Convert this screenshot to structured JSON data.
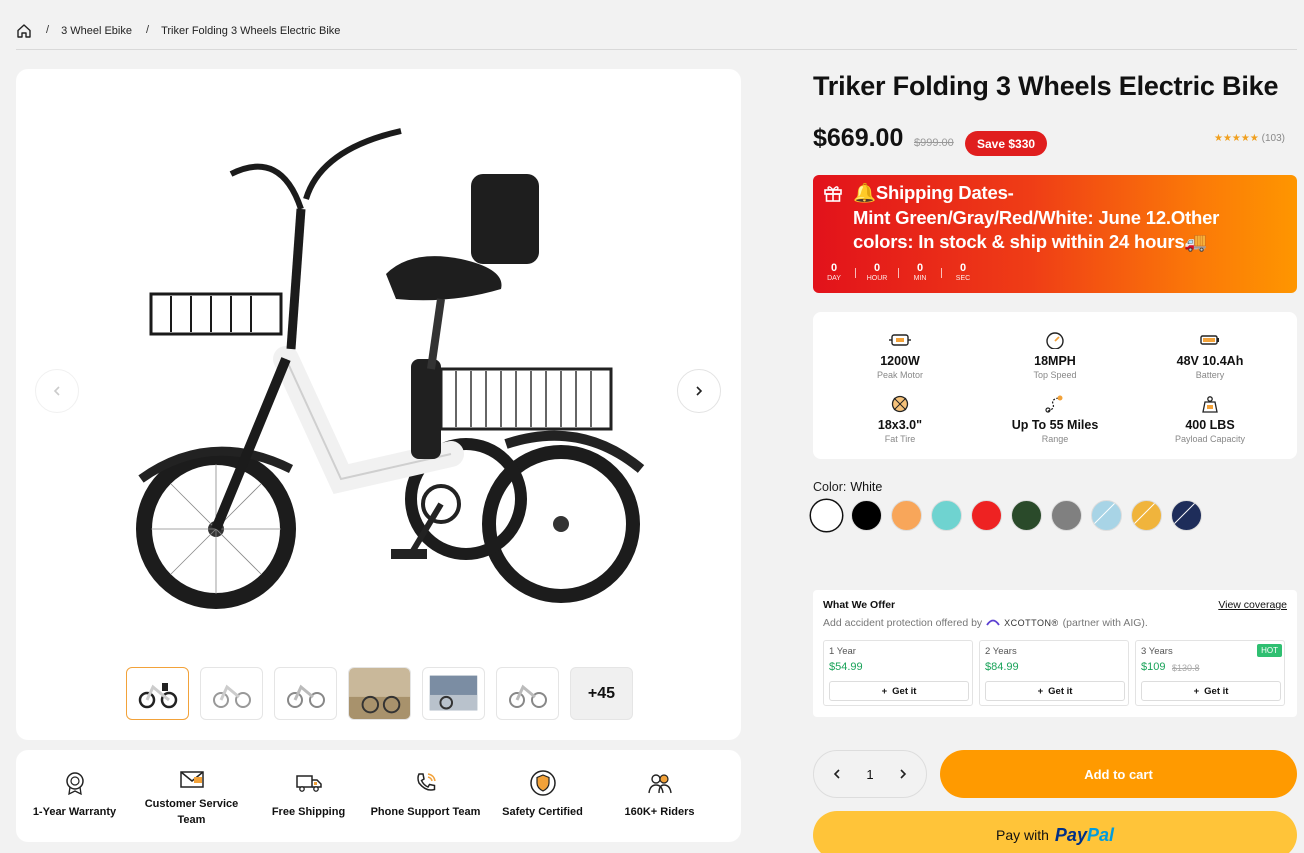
{
  "breadcrumb": {
    "home_icon": "home-icon",
    "items": [
      "3 Wheel Ebike",
      "Triker Folding 3 Wheels Electric Bike"
    ]
  },
  "product": {
    "title": "Triker Folding 3 Wheels Electric Bike",
    "price": "$669.00",
    "old_price": "$999.00",
    "save": "Save $330",
    "rating_stars": "★★★★★",
    "rating_count": "(103)"
  },
  "shipping": {
    "line": "🔔Shipping Dates-\nMint Green/Gray/Red/White: June 12.Other colors: In stock & ship within 24 hours🚚",
    "countdown": [
      {
        "value": "0",
        "unit": "DAY"
      },
      {
        "value": "0",
        "unit": "HOUR"
      },
      {
        "value": "0",
        "unit": "MIN"
      },
      {
        "value": "0",
        "unit": "SEC"
      }
    ]
  },
  "specs": [
    {
      "value": "1200W",
      "label": "Peak Motor",
      "icon": "motor-icon"
    },
    {
      "value": "18MPH",
      "label": "Top Speed",
      "icon": "speedometer-icon"
    },
    {
      "value": "48V 10.4Ah",
      "label": "Battery",
      "icon": "battery-icon"
    },
    {
      "value": "18x3.0\"",
      "label": "Fat Tire",
      "icon": "tire-icon"
    },
    {
      "value": "Up To 55 Miles",
      "label": "Range",
      "icon": "route-icon"
    },
    {
      "value": "400 LBS",
      "label": "Payload Capacity",
      "icon": "weight-icon"
    }
  ],
  "color": {
    "label": "Color:",
    "selected": "White",
    "swatches": [
      "#ffffff",
      "#000000",
      "#f8a65a",
      "#6fd3d0",
      "#ee2222",
      "#2a4a2a",
      "#808080",
      "#a8d4e6",
      "#f0b43c",
      "#1e2d5a"
    ]
  },
  "offer": {
    "heading": "What We Offer",
    "view_coverage": "View coverage",
    "sub_before": "Add accident protection offered by",
    "brand": "XCOTTON®",
    "sub_after": "(partner with AIG).",
    "plans": [
      {
        "term": "1 Year",
        "price": "$54.99",
        "old": "",
        "button": "Get it",
        "hot": ""
      },
      {
        "term": "2 Years",
        "price": "$84.99",
        "old": "",
        "button": "Get it",
        "hot": ""
      },
      {
        "term": "3 Years",
        "price": "$109",
        "old": "$130.8",
        "button": "Get it",
        "hot": "HOT"
      }
    ]
  },
  "purchase": {
    "quantity": "1",
    "add_to_cart": "Add to cart",
    "pay_with": "Pay with",
    "paypal_a": "Pay",
    "paypal_b": "Pal"
  },
  "gallery": {
    "more": "+45"
  },
  "features": [
    {
      "label": "1-Year Warranty",
      "icon": "warranty-badge-icon"
    },
    {
      "label": "Customer Service Team",
      "icon": "mail-icon"
    },
    {
      "label": "Free Shipping",
      "icon": "delivery-truck-icon"
    },
    {
      "label": "Phone Support Team",
      "icon": "phone-icon"
    },
    {
      "label": "Safety Certified",
      "icon": "shield-icon"
    },
    {
      "label": "160K+ Riders",
      "icon": "riders-icon"
    }
  ]
}
